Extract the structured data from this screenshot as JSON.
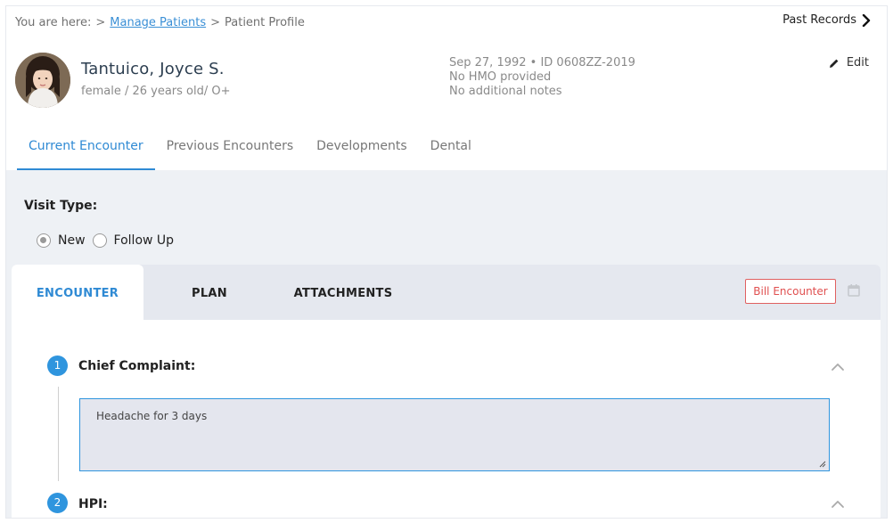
{
  "breadcrumb": {
    "prefix": "You are here:",
    "sep1": ">",
    "link": "Manage Patients",
    "sep2": ">",
    "current": "Patient Profile"
  },
  "past_records_label": "Past Records",
  "patient": {
    "name": "Tantuico, Joyce S.",
    "summary": "female / 26 years old/ O+",
    "details_line": "Sep 27, 1992 • ID 0608ZZ-2019",
    "hmo": "No HMO provided",
    "notes": "No additional notes"
  },
  "edit_label": "Edit",
  "tabs": [
    {
      "label": "Current Encounter",
      "active": true
    },
    {
      "label": "Previous Encounters",
      "active": false
    },
    {
      "label": "Developments",
      "active": false
    },
    {
      "label": "Dental",
      "active": false
    }
  ],
  "visit_type": {
    "label": "Visit Type:",
    "options": [
      {
        "label": "New",
        "checked": true
      },
      {
        "label": "Follow Up",
        "checked": false
      }
    ]
  },
  "panel_tabs": [
    {
      "label": "ENCOUNTER",
      "active": true
    },
    {
      "label": "PLAN",
      "active": false
    },
    {
      "label": "ATTACHMENTS",
      "active": false
    }
  ],
  "bill_button_label": "Bill Encounter",
  "sections": [
    {
      "number": "1",
      "title": "Chief Complaint:",
      "value": "Headache for 3 days"
    },
    {
      "number": "2",
      "title": "HPI:"
    }
  ],
  "icons": {
    "past_records": "chevron-right-icon",
    "edit": "pencil-icon",
    "calendar": "calendar-icon",
    "collapse": "chevron-up-icon"
  },
  "colors": {
    "accent": "#2f8ad4",
    "step_badge": "#2f95de",
    "bill_button": "#e05050",
    "page_bg": "#eef1f5"
  }
}
